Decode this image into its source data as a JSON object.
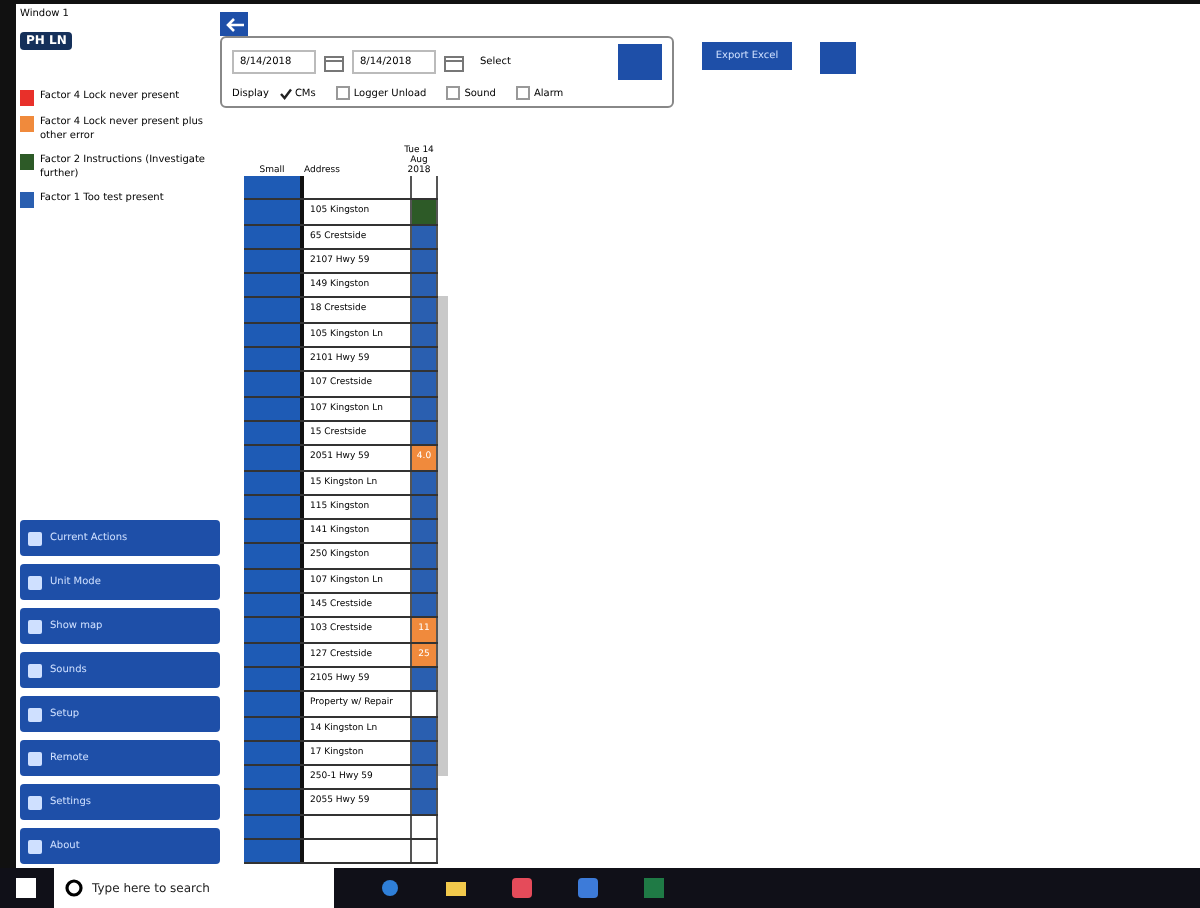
{
  "window": {
    "title": "Window 1"
  },
  "logo": "PH LN",
  "legend": [
    {
      "label": "Factor 4  Lock never present",
      "color": "#e8302a"
    },
    {
      "label": "Factor 4  Lock never present plus other error",
      "color": "#f08a3c"
    },
    {
      "label": "Factor 2  Instructions (Investigate further)",
      "color": "#2d5a27"
    },
    {
      "label": "Factor 1  Too test present",
      "color": "#2a5fb0"
    }
  ],
  "nav": [
    "Current Actions",
    "Unit Mode",
    "Show map",
    "Sounds",
    "Setup",
    "Remote",
    "Settings",
    "About"
  ],
  "filter": {
    "from": "8/14/2018",
    "to": "8/14/2018",
    "select": "Select",
    "display_label": "Display",
    "options": [
      {
        "label": "CMs",
        "checked": true
      },
      {
        "label": "Logger Unload",
        "checked": false
      },
      {
        "label": "Sound",
        "checked": false
      },
      {
        "label": "Alarm",
        "checked": false
      }
    ]
  },
  "export_button": "Export Excel",
  "table": {
    "columns": [
      "Small",
      "Address",
      "Tue 14 Aug 2018"
    ],
    "rows": [
      {
        "color": "#ffffff"
      },
      {
        "address": "105 Kingston",
        "color": "#2d5a27"
      },
      {
        "address": "65 Crestside",
        "color": "#2a5fb0"
      },
      {
        "address": "2107 Hwy 59",
        "color": "#2a5fb0"
      },
      {
        "address": "149 Kingston",
        "color": "#2a5fb0"
      },
      {
        "address": "18 Crestside",
        "color": "#2a5fb0"
      },
      {
        "address": "105 Kingston Ln",
        "color": "#2a5fb0"
      },
      {
        "address": "2101 Hwy 59",
        "color": "#2a5fb0"
      },
      {
        "address": "107 Crestside",
        "color": "#2a5fb0"
      },
      {
        "address": "107 Kingston Ln",
        "color": "#2a5fb0"
      },
      {
        "address": "15 Crestside",
        "color": "#2a5fb0"
      },
      {
        "address": "2051 Hwy 59",
        "status": "4.0",
        "color": "#f08a3c"
      },
      {
        "address": "15 Kingston Ln",
        "color": "#2a5fb0"
      },
      {
        "address": "115 Kingston",
        "color": "#2a5fb0"
      },
      {
        "address": "141 Kingston",
        "color": "#2a5fb0"
      },
      {
        "address": "250 Kingston",
        "color": "#2a5fb0"
      },
      {
        "address": "107 Kingston Ln",
        "color": "#2a5fb0"
      },
      {
        "address": "145 Crestside",
        "color": "#2a5fb0"
      },
      {
        "address": "103 Crestside",
        "status": "11",
        "color": "#f08a3c"
      },
      {
        "address": "127 Crestside",
        "status": "25",
        "color": "#f08a3c"
      },
      {
        "address": "2105 Hwy 59",
        "color": "#2a5fb0"
      },
      {
        "address": "Property w/ Repair",
        "color": "#ffffff"
      },
      {
        "address": "14 Kingston Ln",
        "color": "#2a5fb0"
      },
      {
        "address": "17 Kingston",
        "color": "#2a5fb0"
      },
      {
        "address": "250-1 Hwy 59",
        "color": "#2a5fb0"
      },
      {
        "address": "2055 Hwy 59",
        "color": "#2a5fb0"
      },
      {
        "color": "#ffffff"
      },
      {
        "color": "#ffffff"
      }
    ]
  },
  "taskbar": {
    "search_placeholder": "Type here to search"
  }
}
